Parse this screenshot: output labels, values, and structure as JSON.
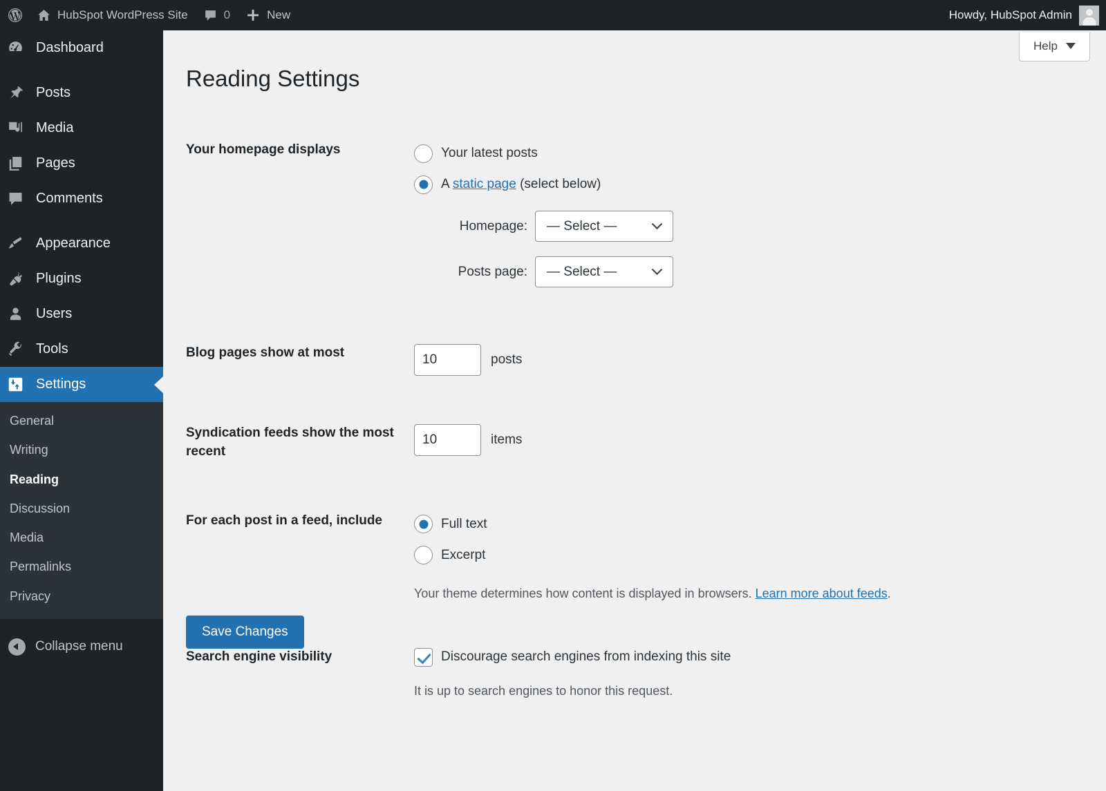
{
  "adminbar": {
    "logo_icon": "wordpress-logo-icon",
    "site_icon": "home-icon",
    "site_name": "HubSpot WordPress Site",
    "comments_icon": "comment-bubble-icon",
    "comments_count": "0",
    "new_icon": "plus-icon",
    "new_label": "New",
    "howdy": "Howdy, HubSpot Admin",
    "avatar_name": "user-avatar"
  },
  "sidebar": {
    "items": [
      {
        "label": "Dashboard",
        "icon": "dashboard-icon",
        "current": false
      },
      {
        "label": "Posts",
        "icon": "pin-icon",
        "current": false
      },
      {
        "label": "Media",
        "icon": "media-icon",
        "current": false
      },
      {
        "label": "Pages",
        "icon": "pages-icon",
        "current": false
      },
      {
        "label": "Comments",
        "icon": "comment-bubble-icon",
        "current": false
      },
      {
        "label": "Appearance",
        "icon": "paintbrush-icon",
        "current": false
      },
      {
        "label": "Plugins",
        "icon": "plug-icon",
        "current": false
      },
      {
        "label": "Users",
        "icon": "user-icon",
        "current": false
      },
      {
        "label": "Tools",
        "icon": "wrench-icon",
        "current": false
      },
      {
        "label": "Settings",
        "icon": "settings-sliders-icon",
        "current": true
      }
    ],
    "submenu": [
      {
        "label": "General",
        "active": false
      },
      {
        "label": "Writing",
        "active": false
      },
      {
        "label": "Reading",
        "active": true
      },
      {
        "label": "Discussion",
        "active": false
      },
      {
        "label": "Media",
        "active": false
      },
      {
        "label": "Permalinks",
        "active": false
      },
      {
        "label": "Privacy",
        "active": false
      }
    ],
    "collapse_label": "Collapse menu",
    "collapse_icon": "chevron-left-circle-icon"
  },
  "help": {
    "label": "Help",
    "icon": "triangle-down-icon"
  },
  "page": {
    "title": "Reading Settings"
  },
  "homepage_displays": {
    "label": "Your homepage displays",
    "option_latest": "Your latest posts",
    "option_static_prefix": "A",
    "option_static_link": "static page",
    "option_static_suffix": "(select below)",
    "selected": "static",
    "homepage_label": "Homepage:",
    "homepage_value": "— Select —",
    "posts_page_label": "Posts page:",
    "posts_page_value": "— Select —",
    "select_chevron_icon": "chevron-down-icon"
  },
  "blog_pages": {
    "label": "Blog pages show at most",
    "value": "10",
    "unit": "posts"
  },
  "syndication": {
    "label": "Syndication feeds show the most recent",
    "value": "10",
    "unit": "items"
  },
  "feed_include": {
    "label": "For each post in a feed, include",
    "option_full": "Full text",
    "option_excerpt": "Excerpt",
    "selected": "full",
    "description_text": "Your theme determines how content is displayed in browsers.",
    "description_link": "Learn more about feeds",
    "description_end": "."
  },
  "search_visibility": {
    "label": "Search engine visibility",
    "checkbox_label": "Discourage search engines from indexing this site",
    "checked": true,
    "note": "It is up to search engines to honor this request."
  },
  "save": {
    "label": "Save Changes"
  },
  "colors": {
    "sidebar_bg": "#1d2327",
    "submenu_bg": "#2c3338",
    "accent_blue": "#2271b1",
    "link_blue": "#2271b1",
    "main_bg": "#f0f0f1"
  }
}
